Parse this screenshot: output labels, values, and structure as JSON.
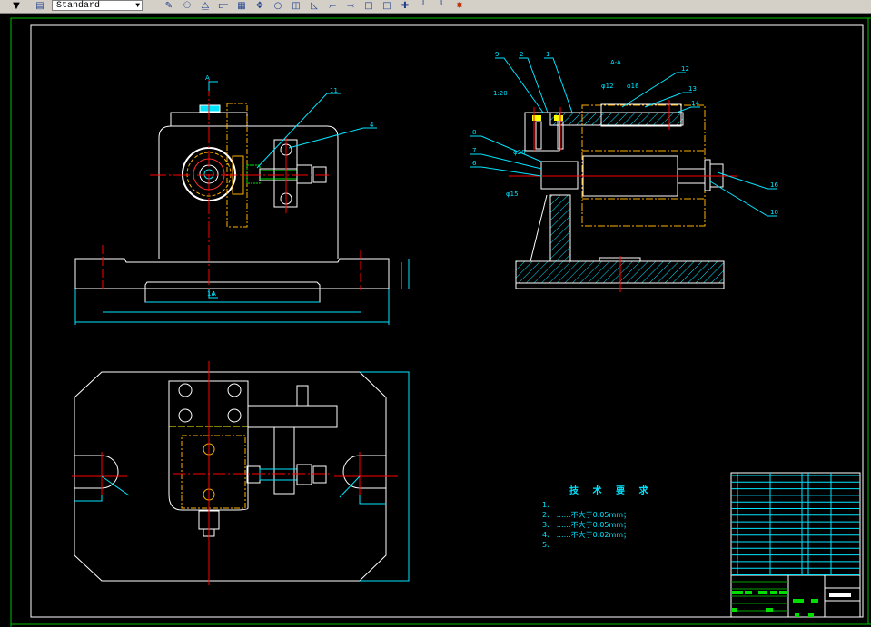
{
  "toolbar": {
    "text_style": "Standard",
    "icons": [
      "layer-dropdown-arrow",
      "text-style-icon",
      "erase-icon",
      "copy-icon",
      "mirror-icon",
      "offset-icon",
      "array-icon",
      "move-icon",
      "rotate-icon",
      "scale-icon",
      "stretch-icon",
      "trim-icon",
      "extend-icon",
      "break-icon",
      "break-at-point-icon",
      "join-icon",
      "chamfer-icon",
      "fillet-icon",
      "explode-icon"
    ]
  },
  "drawing": {
    "section_marks": {
      "top": "A",
      "bottom": "A"
    },
    "section_title": "A-A",
    "front_view_balloons": [
      "11",
      "4"
    ],
    "section_view_balloons": [
      "9",
      "2",
      "1",
      "8",
      "7",
      "6",
      "12",
      "13",
      "14",
      "16",
      "10"
    ],
    "section_note": "1:20",
    "fit_labels": [
      "φ12",
      "φ16",
      "φ20",
      "φ15"
    ],
    "dimension_marker": "14"
  },
  "technical_requirements": {
    "title": "技 术 要 求",
    "items": [
      "1、",
      "2、 ……不大于0.05mm；",
      "3、 ……不大于0.05mm；",
      "4、 ……不大于0.02mm；",
      "5、"
    ]
  },
  "colors": {
    "background": "#000000",
    "outline": "#ffffff",
    "dimension": "#00e5ff",
    "centerline": "#ff0000",
    "hidden": "#ffb000",
    "frame": "#00c000",
    "highlight": "#ffff00"
  }
}
